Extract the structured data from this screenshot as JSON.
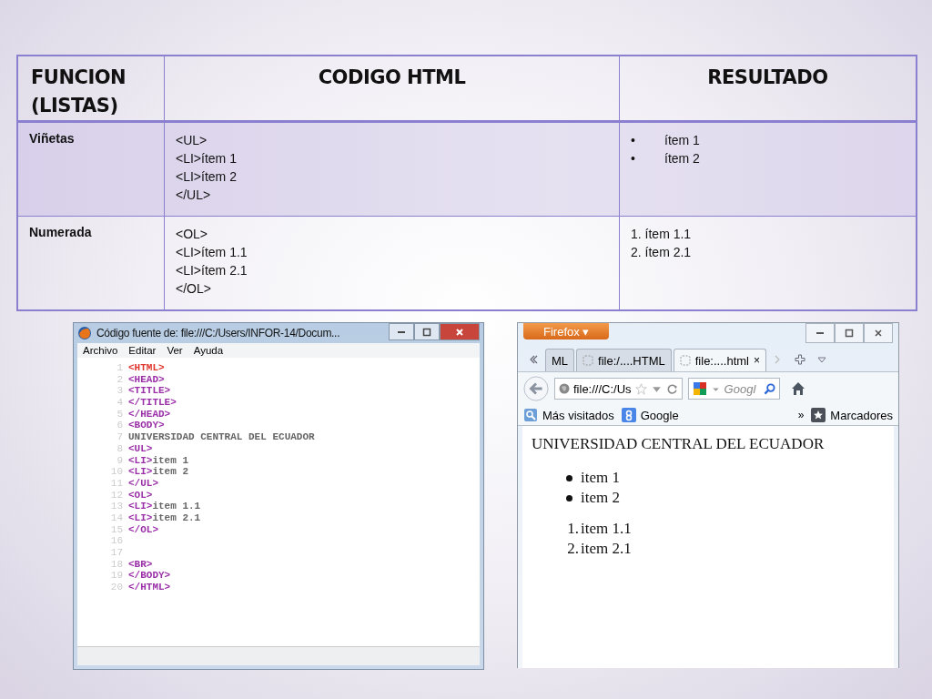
{
  "table": {
    "columns": [
      "FUNCION (LISTAS)",
      "CODIGO HTML",
      "RESULTADO"
    ],
    "rows": [
      {
        "function": "Viñetas",
        "code": [
          "<UL>",
          "<LI>ítem 1",
          "<LI>ítem 2",
          "</UL>"
        ],
        "result": [
          {
            "marker": "•",
            "text": "ítem 1"
          },
          {
            "marker": "•",
            "text": "ítem 2"
          }
        ]
      },
      {
        "function": "Numerada",
        "code": [
          "<OL>",
          "<LI>ítem 1.1",
          "<LI>ítem 2.1",
          "</OL>"
        ],
        "result": [
          {
            "text": "1. ítem 1.1"
          },
          {
            "text": "2. ítem 2.1"
          }
        ]
      }
    ]
  },
  "source_window": {
    "title": "Código fuente de: file:///C:/Users/INFOR-14/Docum...",
    "menu": [
      "Archivo",
      "Editar",
      "Ver",
      "Ayuda"
    ],
    "lines": [
      {
        "number": "1",
        "segments": [
          {
            "kind": "root",
            "text": "<HTML>"
          }
        ]
      },
      {
        "number": "2",
        "segments": [
          {
            "kind": "tag",
            "text": "<HEAD>"
          }
        ]
      },
      {
        "number": "3",
        "segments": [
          {
            "kind": "tag",
            "text": "<TITLE>"
          }
        ]
      },
      {
        "number": "4",
        "segments": [
          {
            "kind": "tag",
            "text": "</TITLE>"
          }
        ]
      },
      {
        "number": "5",
        "segments": [
          {
            "kind": "tag",
            "text": "</HEAD>"
          }
        ]
      },
      {
        "number": "6",
        "segments": [
          {
            "kind": "tag",
            "text": "<BODY>"
          }
        ]
      },
      {
        "number": "7",
        "segments": [
          {
            "kind": "plain",
            "text": "UNIVERSIDAD CENTRAL DEL ECUADOR"
          }
        ]
      },
      {
        "number": "8",
        "segments": [
          {
            "kind": "tag",
            "text": "<UL>"
          }
        ]
      },
      {
        "number": "9",
        "segments": [
          {
            "kind": "tag",
            "text": "<LI>"
          },
          {
            "kind": "plain",
            "text": "item 1"
          }
        ]
      },
      {
        "number": "10",
        "segments": [
          {
            "kind": "tag",
            "text": "<LI>"
          },
          {
            "kind": "plain",
            "text": "item 2"
          }
        ]
      },
      {
        "number": "11",
        "segments": [
          {
            "kind": "tag",
            "text": "</UL>"
          }
        ]
      },
      {
        "number": "12",
        "segments": [
          {
            "kind": "tag",
            "text": "<OL>"
          }
        ]
      },
      {
        "number": "13",
        "segments": [
          {
            "kind": "tag",
            "text": "<LI>"
          },
          {
            "kind": "plain",
            "text": "item 1.1"
          }
        ]
      },
      {
        "number": "14",
        "segments": [
          {
            "kind": "tag",
            "text": "<LI>"
          },
          {
            "kind": "plain",
            "text": "item 2.1"
          }
        ]
      },
      {
        "number": "15",
        "segments": [
          {
            "kind": "tag",
            "text": "</OL>"
          }
        ]
      },
      {
        "number": "16"
      },
      {
        "number": "17"
      },
      {
        "number": "18",
        "segments": [
          {
            "kind": "tag",
            "text": "<BR>"
          }
        ]
      },
      {
        "number": "19",
        "segments": [
          {
            "kind": "tag",
            "text": "</BODY>"
          }
        ]
      },
      {
        "number": "20",
        "segments": [
          {
            "kind": "tag",
            "text": "</HTML>"
          }
        ]
      }
    ]
  },
  "browser": {
    "app_button": "Firefox ▾",
    "tabs": [
      {
        "label": "ML",
        "selected": false,
        "icon": false
      },
      {
        "label": "file:/....HTML",
        "selected": false,
        "icon": true
      },
      {
        "label": "file:....html",
        "selected": true,
        "icon": true
      }
    ],
    "tab_close": "×",
    "url": "file:///C:/Us",
    "search_placeholder": "Googl",
    "bookmarks": [
      {
        "kind": "folder",
        "label": "Más visitados"
      },
      {
        "kind": "google",
        "label": "Google"
      },
      {
        "kind": "chevron",
        "label": "»"
      },
      {
        "kind": "star",
        "label": "Marcadores"
      }
    ],
    "content": {
      "heading": "UNIVERSIDAD CENTRAL DEL ECUADOR",
      "bullets": [
        "item 1",
        "item 2"
      ],
      "numbered": [
        {
          "number": "1.",
          "text": "item 1.1"
        },
        {
          "number": "2.",
          "text": "item 2.1"
        }
      ]
    }
  }
}
